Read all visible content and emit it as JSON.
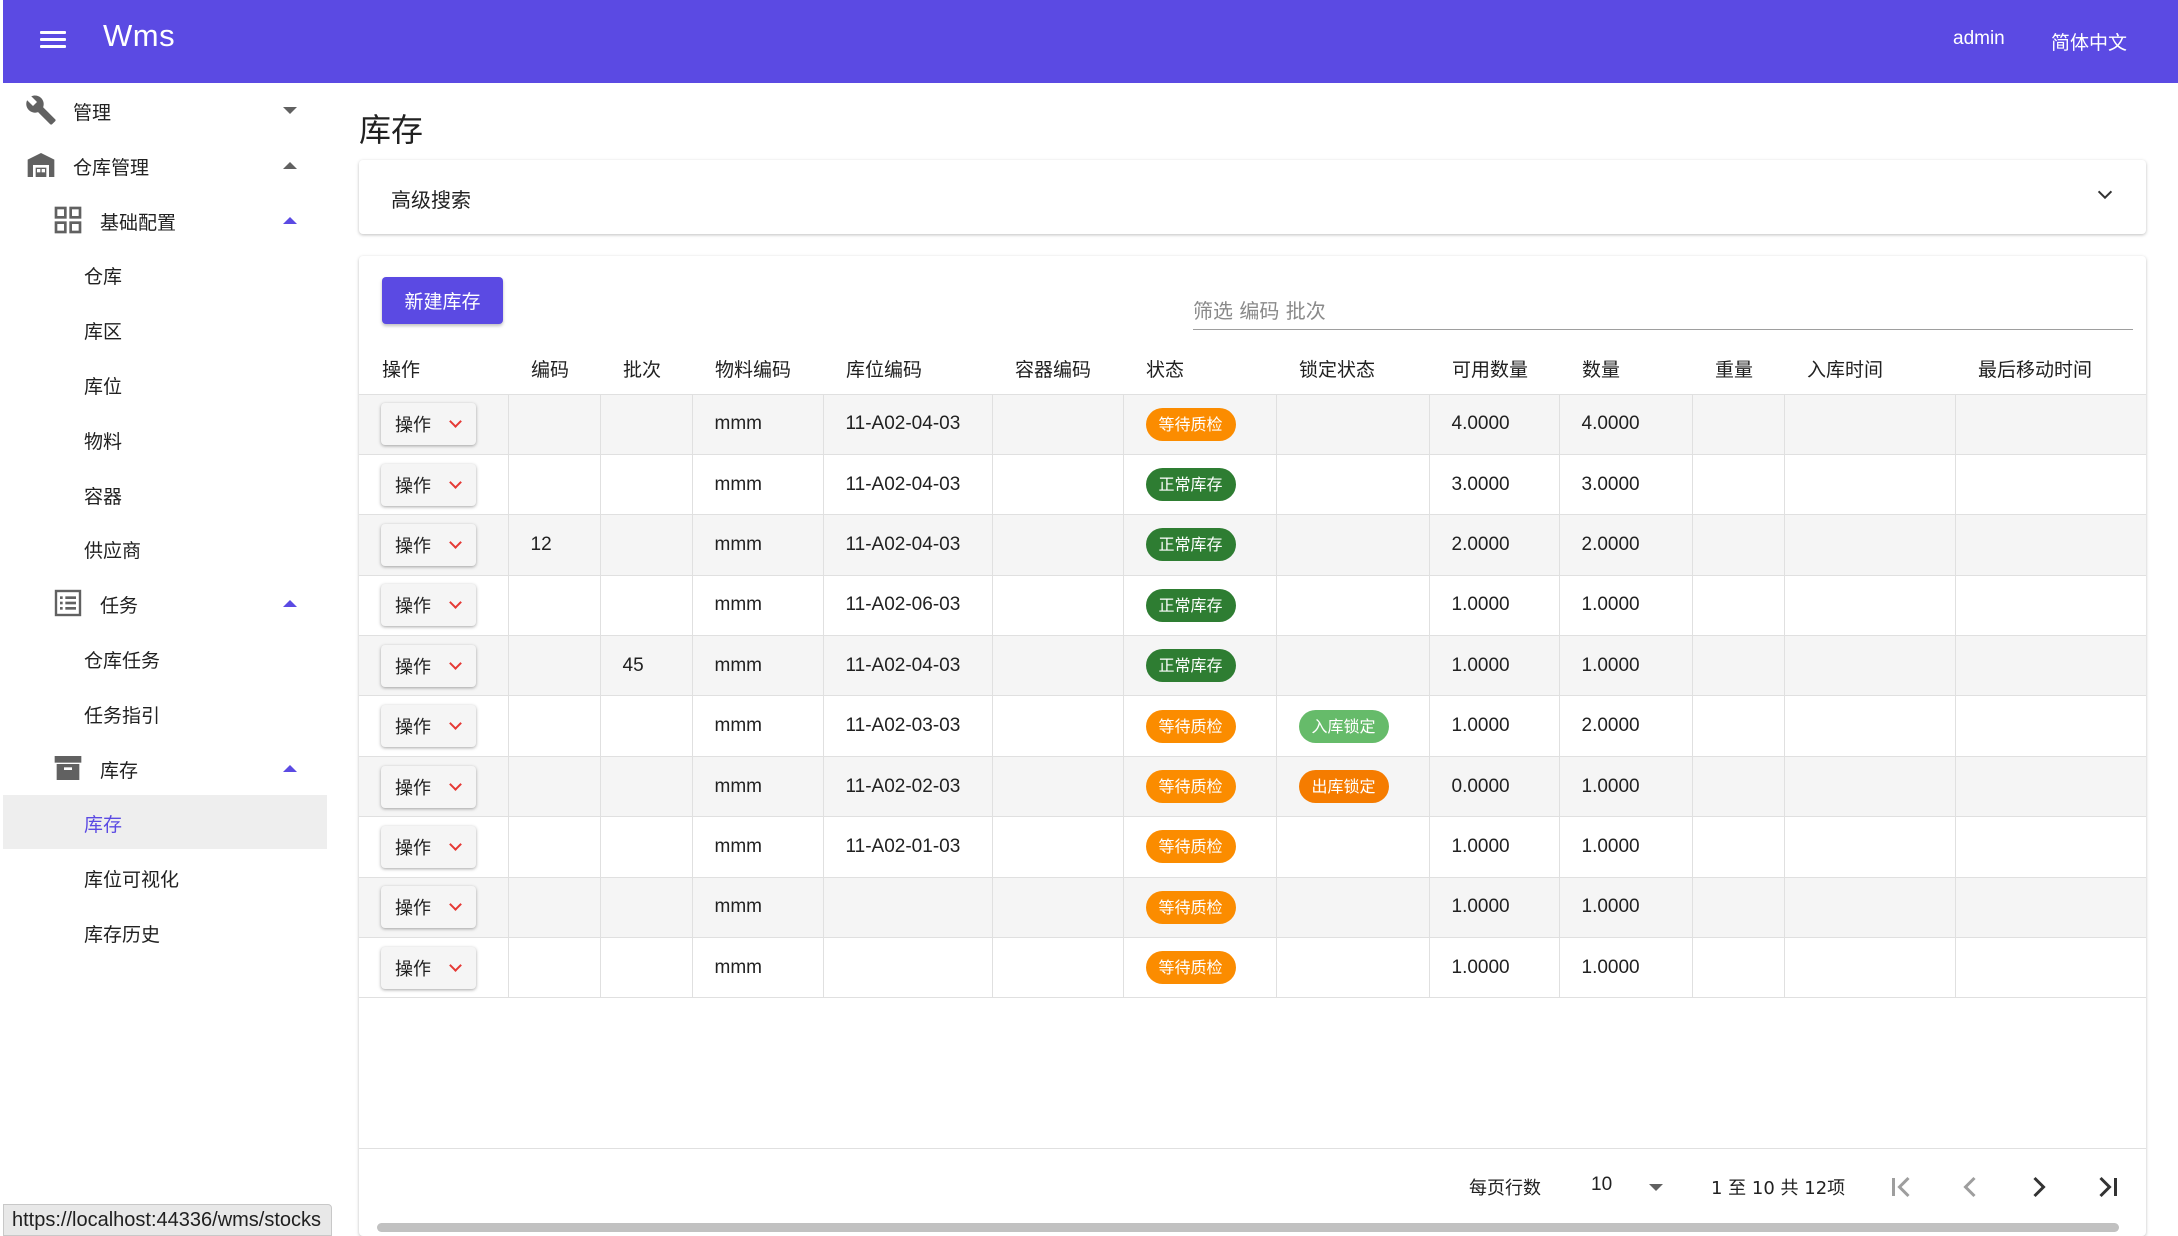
{
  "app": {
    "title": "Wms",
    "user": "admin",
    "language": "简体中文"
  },
  "sidebar": {
    "items": [
      {
        "label": "管理",
        "icon": "wrench-icon",
        "level": 0,
        "expanded": false
      },
      {
        "label": "仓库管理",
        "icon": "warehouse-icon",
        "level": 0,
        "expanded": true
      },
      {
        "label": "基础配置",
        "icon": "grid-icon",
        "level": 1,
        "expanded": true
      },
      {
        "label": "仓库",
        "level": 2
      },
      {
        "label": "库区",
        "level": 2
      },
      {
        "label": "库位",
        "level": 2
      },
      {
        "label": "物料",
        "level": 2
      },
      {
        "label": "容器",
        "level": 2
      },
      {
        "label": "供应商",
        "level": 2
      },
      {
        "label": "任务",
        "icon": "list-icon",
        "level": 1,
        "expanded": true
      },
      {
        "label": "仓库任务",
        "level": 2
      },
      {
        "label": "任务指引",
        "level": 2
      },
      {
        "label": "库存",
        "icon": "archive-icon",
        "level": 1,
        "expanded": true
      },
      {
        "label": "库存",
        "level": 2,
        "active": true
      },
      {
        "label": "库位可视化",
        "level": 2
      },
      {
        "label": "库存历史",
        "level": 2
      }
    ]
  },
  "main": {
    "page_title": "库存",
    "advanced_search": "高级搜索",
    "new_button": "新建库存",
    "filter_placeholder": "筛选 编码 批次",
    "columns": [
      "操作",
      "编码",
      "批次",
      "物料编码",
      "库位编码",
      "容器编码",
      "状态",
      "锁定状态",
      "可用数量",
      "数量",
      "重量",
      "入库时间",
      "最后移动时间"
    ],
    "action_label": "操作",
    "rows": [
      {
        "code": "",
        "batch": "",
        "material": "mmm",
        "location": "11-A02-04-03",
        "container": "",
        "status": "等待质检",
        "status_color": "#fb8c00",
        "lock": "",
        "lock_color": "",
        "available": "4.0000",
        "qty": "4.0000",
        "weight": "",
        "in_time": "",
        "last_move": ""
      },
      {
        "code": "",
        "batch": "",
        "material": "mmm",
        "location": "11-A02-04-03",
        "container": "",
        "status": "正常库存",
        "status_color": "#2e7d32",
        "lock": "",
        "lock_color": "",
        "available": "3.0000",
        "qty": "3.0000",
        "weight": "",
        "in_time": "",
        "last_move": ""
      },
      {
        "code": "12",
        "batch": "",
        "material": "mmm",
        "location": "11-A02-04-03",
        "container": "",
        "status": "正常库存",
        "status_color": "#2e7d32",
        "lock": "",
        "lock_color": "",
        "available": "2.0000",
        "qty": "2.0000",
        "weight": "",
        "in_time": "",
        "last_move": ""
      },
      {
        "code": "",
        "batch": "",
        "material": "mmm",
        "location": "11-A02-06-03",
        "container": "",
        "status": "正常库存",
        "status_color": "#2e7d32",
        "lock": "",
        "lock_color": "",
        "available": "1.0000",
        "qty": "1.0000",
        "weight": "",
        "in_time": "",
        "last_move": ""
      },
      {
        "code": "",
        "batch": "45",
        "material": "mmm",
        "location": "11-A02-04-03",
        "container": "",
        "status": "正常库存",
        "status_color": "#2e7d32",
        "lock": "",
        "lock_color": "",
        "available": "1.0000",
        "qty": "1.0000",
        "weight": "",
        "in_time": "",
        "last_move": ""
      },
      {
        "code": "",
        "batch": "",
        "material": "mmm",
        "location": "11-A02-03-03",
        "container": "",
        "status": "等待质检",
        "status_color": "#fb8c00",
        "lock": "入库锁定",
        "lock_color": "#66bb6a",
        "available": "1.0000",
        "qty": "2.0000",
        "weight": "",
        "in_time": "",
        "last_move": ""
      },
      {
        "code": "",
        "batch": "",
        "material": "mmm",
        "location": "11-A02-02-03",
        "container": "",
        "status": "等待质检",
        "status_color": "#fb8c00",
        "lock": "出库锁定",
        "lock_color": "#f57c00",
        "available": "0.0000",
        "qty": "1.0000",
        "weight": "",
        "in_time": "",
        "last_move": ""
      },
      {
        "code": "",
        "batch": "",
        "material": "mmm",
        "location": "11-A02-01-03",
        "container": "",
        "status": "等待质检",
        "status_color": "#fb8c00",
        "lock": "",
        "lock_color": "",
        "available": "1.0000",
        "qty": "1.0000",
        "weight": "",
        "in_time": "",
        "last_move": ""
      },
      {
        "code": "",
        "batch": "",
        "material": "mmm",
        "location": "",
        "container": "",
        "status": "等待质检",
        "status_color": "#fb8c00",
        "lock": "",
        "lock_color": "",
        "available": "1.0000",
        "qty": "1.0000",
        "weight": "",
        "in_time": "",
        "last_move": ""
      },
      {
        "code": "",
        "batch": "",
        "material": "mmm",
        "location": "",
        "container": "",
        "status": "等待质检",
        "status_color": "#fb8c00",
        "lock": "",
        "lock_color": "",
        "available": "1.0000",
        "qty": "1.0000",
        "weight": "",
        "in_time": "",
        "last_move": ""
      }
    ],
    "pagination": {
      "rows_per_page_label": "每页行数",
      "rows_per_page": "10",
      "range": "1 至 10 共 12项"
    }
  },
  "status_url": "https://localhost:44336/wms/stocks",
  "colors": {
    "primary": "#5b4ae3",
    "pending": "#fb8c00",
    "normal": "#2e7d32"
  }
}
